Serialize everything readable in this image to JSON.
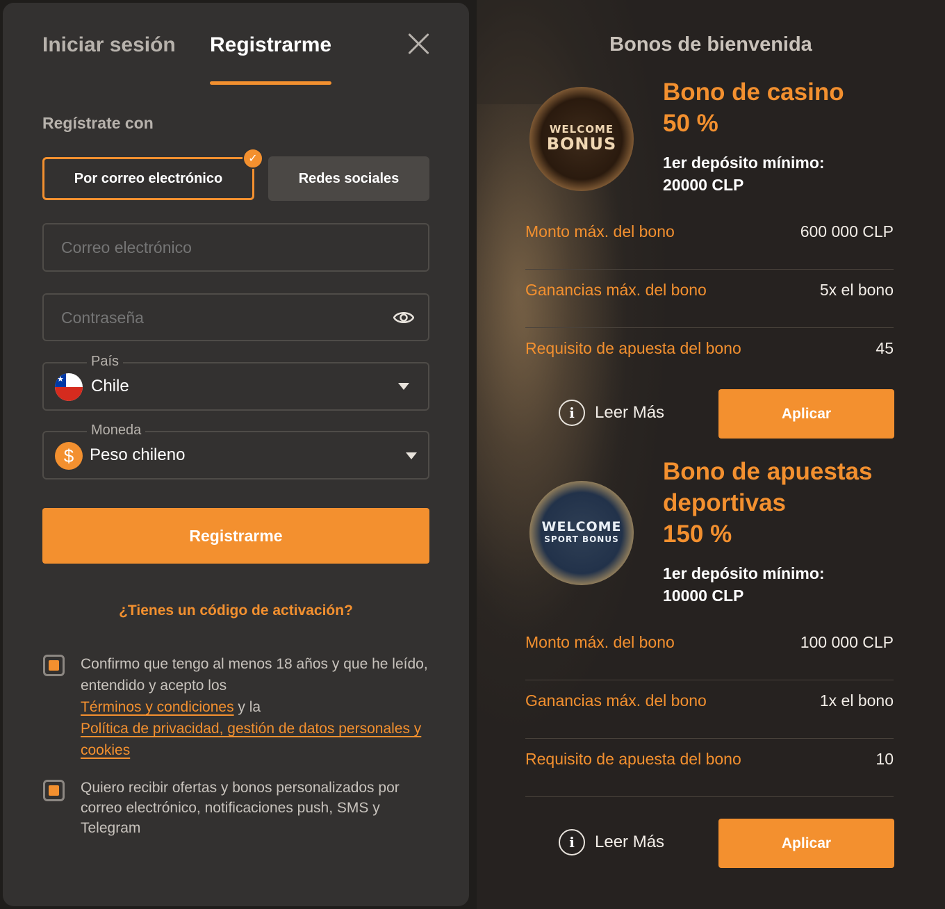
{
  "tabs": {
    "login": "Iniciar sesión",
    "register": "Registrarme"
  },
  "register_with": "Regístrate con",
  "methods": {
    "email": "Por correo electrónico",
    "social": "Redes sociales"
  },
  "fields": {
    "email_placeholder": "Correo electrónico",
    "password_placeholder": "Contraseña",
    "country_label": "País",
    "country_value": "Chile",
    "currency_label": "Moneda",
    "currency_value": "Peso chileno",
    "currency_symbol": "$"
  },
  "register_button": "Registrarme",
  "promo_link": "¿Tienes un código de activación?",
  "consent": {
    "age_text_1": "Confirmo que tengo al menos 18 años y que he leído, entendido y acepto los",
    "terms_link": "Términos y condiciones",
    "and_text": " y la",
    "privacy_link": "Política de privacidad, gestión de datos personales y cookies",
    "offers_text": "Quiero recibir ofertas y bonos personalizados por correo electrónico, notificaciones push, SMS y Telegram",
    "age_checked": true,
    "offers_checked": true
  },
  "bonuses": {
    "heading": "Bonos de bienvenida",
    "read_more": "Leer Más",
    "apply": "Aplicar",
    "casino": {
      "medal_line1": "WELCOME",
      "medal_line2": "BONUS",
      "title_line1": "Bono de casino",
      "title_line2": "50 %",
      "min_label": "1er depósito mínimo:",
      "min_value": "20000 CLP",
      "rows": [
        {
          "k": "Monto máx. del bono",
          "v": "600 000 CLP"
        },
        {
          "k": "Ganancias máx. del bono",
          "v": "5x el bono"
        },
        {
          "k": "Requisito de apuesta del bono",
          "v": "45"
        }
      ]
    },
    "sport": {
      "medal_line1": "WELCOME",
      "medal_line2": "SPORT BONUS",
      "title_line1": "Bono de apuestas",
      "title_line2": "deportivas",
      "title_line3": "150 %",
      "min_label": "1er depósito mínimo:",
      "min_value": "10000 CLP",
      "rows": [
        {
          "k": "Monto máx. del bono",
          "v": "100 000 CLP"
        },
        {
          "k": "Ganancias máx. del bono",
          "v": "1x el bono"
        },
        {
          "k": "Requisito de apuesta del bono",
          "v": "10"
        }
      ]
    }
  },
  "colors": {
    "accent": "#f3902f",
    "panel": "#333130",
    "text_muted": "#b7b2ac"
  },
  "icons": [
    "close-icon",
    "check-icon",
    "eye-icon",
    "chile-flag-icon",
    "chevron-down-icon",
    "dollar-coin-icon",
    "info-icon"
  ]
}
